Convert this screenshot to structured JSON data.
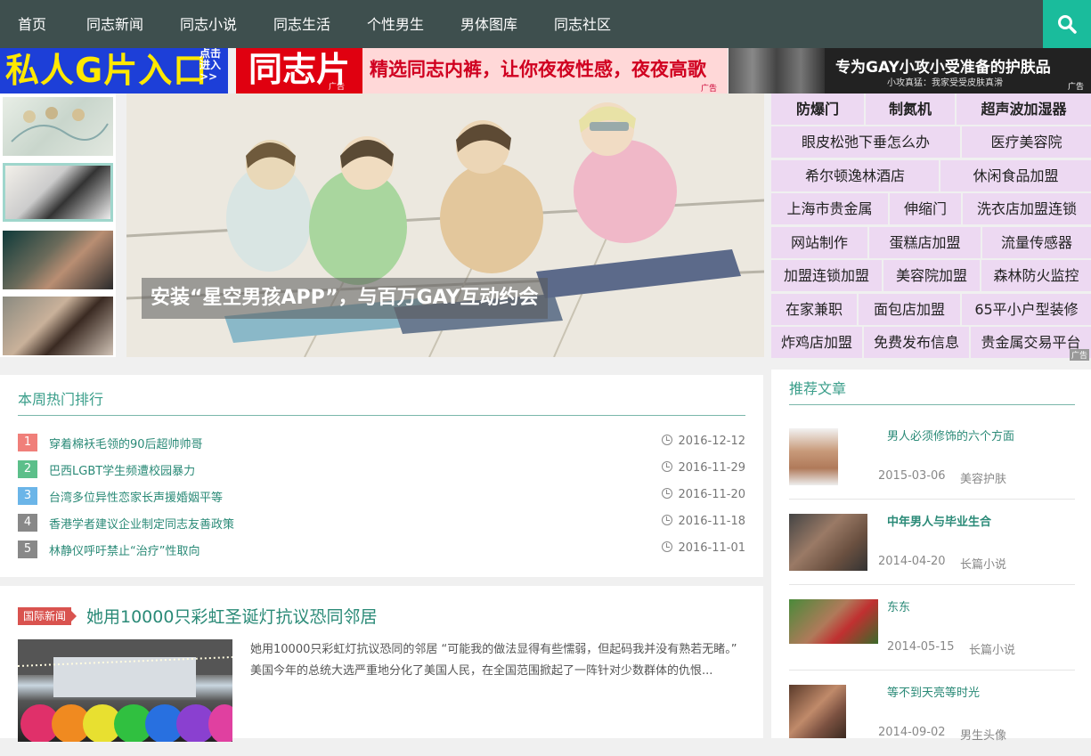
{
  "nav": {
    "items": [
      "首页",
      "同志新闻",
      "同志小说",
      "同志生活",
      "个性男生",
      "男体图库",
      "同志社区"
    ]
  },
  "banners": {
    "b1_main": "私人G片入口",
    "b1_side": "点击进入>>",
    "b2_red": "同志片",
    "b2_ad": "广告",
    "b2_slogan": "精选同志内裤，让你夜夜性感，夜夜高歌",
    "b2_ad2": "广告",
    "b3_title": "专为GAY小攻小受准备的护肤品",
    "b3_sub": "小攻真猛：我家受受皮肤真滑",
    "b3_ad": "广告"
  },
  "slider": {
    "caption": "安装“星空男孩APP”，与百万GAY互动约会"
  },
  "ads_grid": {
    "rows": [
      [
        "防爆门",
        "制氮机",
        "超声波加湿器"
      ],
      [
        "眼皮松弛下垂怎么办",
        "医疗美容院"
      ],
      [
        "希尔顿逸林酒店",
        "休闲食品加盟"
      ],
      [
        "上海市贵金属",
        "伸缩门",
        "洗衣店加盟连锁"
      ],
      [
        "网站制作",
        "蛋糕店加盟",
        "流量传感器"
      ],
      [
        "加盟连锁加盟",
        "美容院加盟",
        "森林防火监控"
      ],
      [
        "在家兼职",
        "面包店加盟",
        "65平小户型装修"
      ],
      [
        "炸鸡店加盟",
        "免费发布信息",
        "贵金属交易平台"
      ]
    ],
    "ad_label": "广告"
  },
  "hot": {
    "title": "本周热门排行",
    "items": [
      {
        "rank": "1",
        "text": "穿着棉袄毛领的90后超帅帅哥",
        "date": "2016-12-12",
        "color": "#f07f7a"
      },
      {
        "rank": "2",
        "text": "巴西LGBT学生频遭校园暴力",
        "date": "2016-11-29",
        "color": "#5cbf8a"
      },
      {
        "rank": "3",
        "text": "台湾多位异性恋家长声援婚姻平等",
        "date": "2016-11-20",
        "color": "#6bb5e8"
      },
      {
        "rank": "4",
        "text": "香港学者建议企业制定同志友善政策",
        "date": "2016-11-18",
        "color": "#888888"
      },
      {
        "rank": "5",
        "text": "林静仪呼吁禁止“治疗”性取向",
        "date": "2016-11-01",
        "color": "#888888"
      }
    ]
  },
  "article": {
    "tag": "国际新闻",
    "title": "她用10000只彩虹圣诞灯抗议恐同邻居",
    "excerpt": "她用10000只彩虹灯抗议恐同的邻居 “可能我的做法显得有些懦弱，但起码我并没有熟若无睹。” 美国今年的总统大选严重地分化了美国人民，在全国范围掀起了一阵针对少数群体的仇恨..."
  },
  "recommended": {
    "title": "推荐文章",
    "items": [
      {
        "name": "男人必须修饰的六个方面",
        "date": "2015-03-06",
        "category": "美容护肤"
      },
      {
        "name": "中年男人与毕业生合",
        "date": "2014-04-20",
        "category": "长篇小说"
      },
      {
        "name": "东东",
        "date": "2014-05-15",
        "category": "长篇小说"
      },
      {
        "name": "等不到天亮等时光",
        "date": "2014-09-02",
        "category": "男生头像"
      }
    ]
  },
  "colors": {
    "nav_bg": "#3e4f4e",
    "accent": "#1abc9c",
    "link": "#2a8a77",
    "ad_cell_bg": "#edd9f2"
  }
}
